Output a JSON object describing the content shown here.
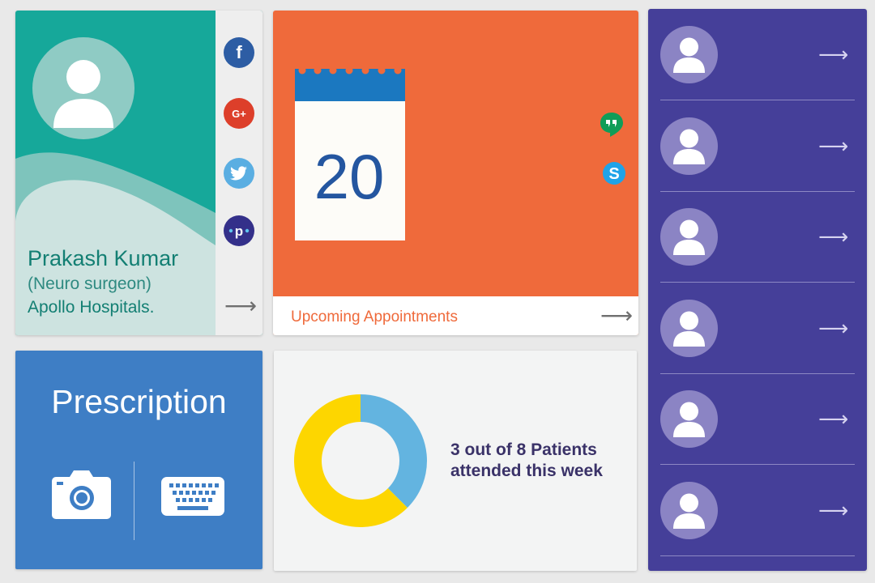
{
  "profile": {
    "name": "Prakash Kumar",
    "role": "(Neuro surgeon)",
    "hospital": "Apollo Hospitals.",
    "social": [
      {
        "icon": "facebook-icon",
        "glyph": "f",
        "color": "#2d5da4"
      },
      {
        "icon": "google-plus-icon",
        "glyph": "G+",
        "color": "#dd3f2a"
      },
      {
        "icon": "twitter-icon",
        "glyph": "t",
        "color": "#5aaee2"
      },
      {
        "icon": "pinboard-icon",
        "glyph": "p",
        "color": "#34308a"
      }
    ],
    "arrow": "⟶"
  },
  "appointments": {
    "day": "20",
    "label": "Upcoming Appointments",
    "arrow": "⟶",
    "apps": [
      {
        "icon": "hangouts-icon",
        "color": "#109d58"
      },
      {
        "icon": "skype-icon",
        "color": "#1fa3e8"
      }
    ]
  },
  "prescription": {
    "title": "Prescription",
    "actions": [
      {
        "icon": "camera-icon"
      },
      {
        "icon": "keyboard-icon"
      }
    ]
  },
  "patients": {
    "line1": "3 out of 8 Patients",
    "line2": "attended this week",
    "attended": 3,
    "total": 8,
    "colors": {
      "attended": "#63b4e0",
      "remaining": "#fdd600"
    }
  },
  "contacts": {
    "count": 6,
    "arrow": "⟶"
  },
  "colors": {
    "teal": "#16a89a",
    "orange": "#ef6a3b",
    "blue": "#3e7ec5",
    "purple": "#453f99"
  }
}
